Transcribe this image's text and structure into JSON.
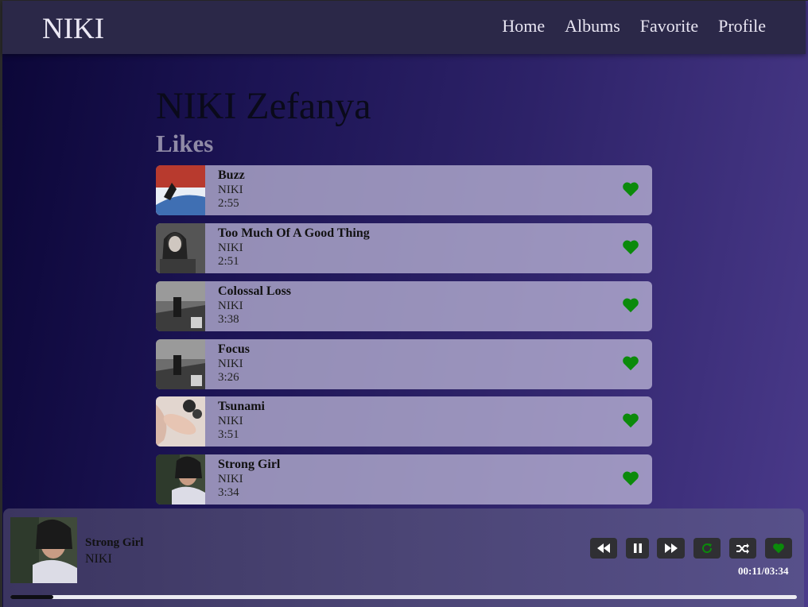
{
  "navbar": {
    "logo": "NIKI",
    "links": [
      "Home",
      "Albums",
      "Favorite",
      "Profile"
    ]
  },
  "artist": {
    "name": "NIKI Zefanya"
  },
  "section": {
    "title": "Likes"
  },
  "songs": [
    {
      "title": "Buzz",
      "artist": "NIKI",
      "duration": "2:55",
      "liked": true
    },
    {
      "title": "Too Much Of A Good Thing",
      "artist": "NIKI",
      "duration": "2:51",
      "liked": true
    },
    {
      "title": "Colossal Loss",
      "artist": "NIKI",
      "duration": "3:38",
      "liked": true
    },
    {
      "title": "Focus",
      "artist": "NIKI",
      "duration": "3:26",
      "liked": true
    },
    {
      "title": "Tsunami",
      "artist": "NIKI",
      "duration": "3:51",
      "liked": true
    },
    {
      "title": "Strong Girl",
      "artist": "NIKI",
      "duration": "3:34",
      "liked": true
    }
  ],
  "player": {
    "song": "Strong Girl",
    "artist": "NIKI",
    "time": "00:11/03:34",
    "progress_fraction": 0.055,
    "controls": [
      "rewind-icon",
      "pause-icon",
      "fast-forward-icon",
      "repeat-icon",
      "shuffle-icon",
      "heart-icon"
    ]
  },
  "colors": {
    "heart": "#0b8a0b",
    "accent": "#2b2848"
  }
}
